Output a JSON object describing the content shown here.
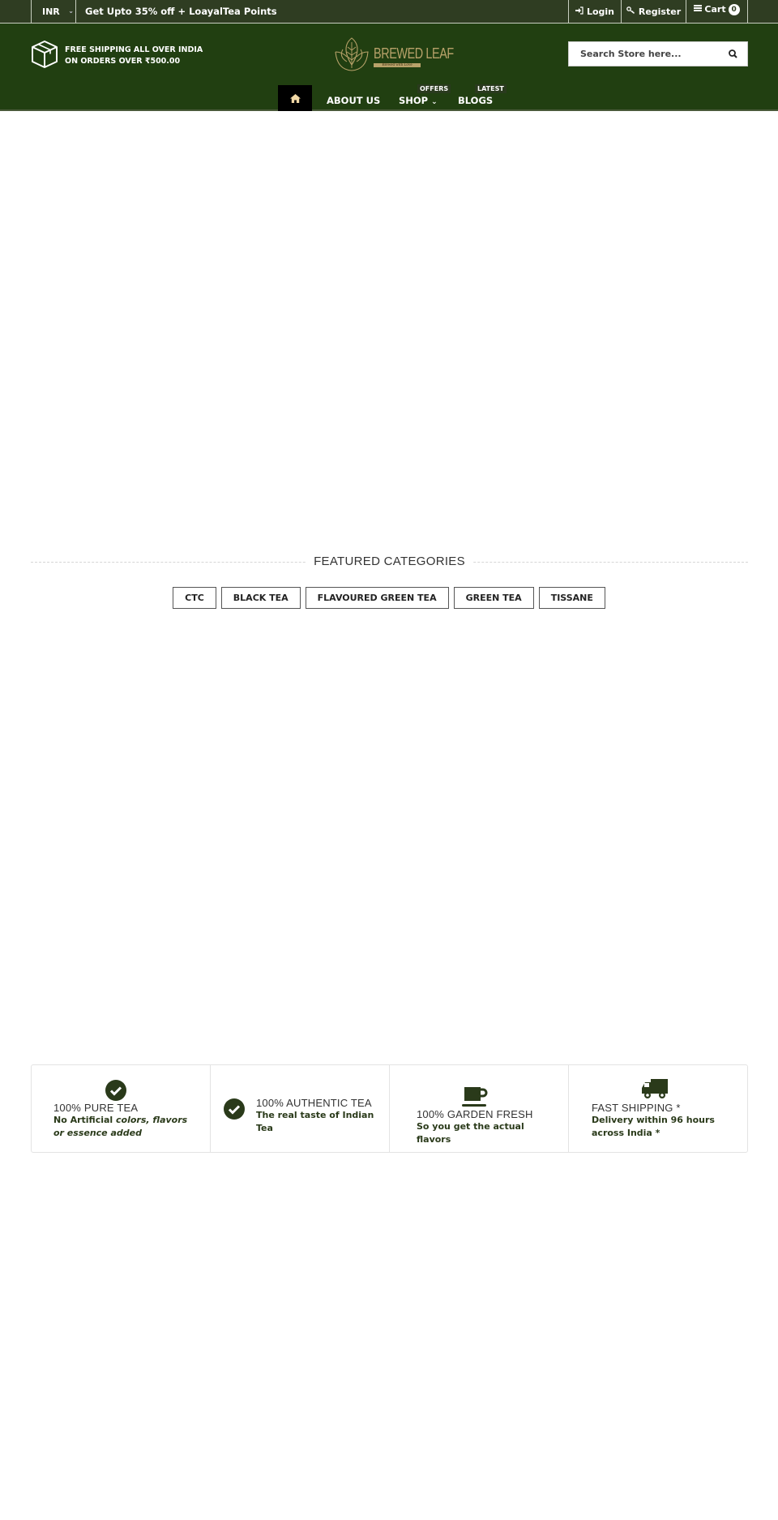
{
  "topbar": {
    "currency": "INR",
    "promo": "Get Upto 35% off + LoayalTea Points",
    "login_label": "Login",
    "register_label": "Register",
    "cart_label": "Cart",
    "cart_count": "0"
  },
  "header": {
    "shipping_line1": "FREE SHIPPING ALL OVER INDIA",
    "shipping_line2": "ON ORDERS OVER ₹500.00",
    "logo_name": "BREWED LEAF",
    "logo_tagline": "Brewed with Love",
    "search_placeholder": "Search Store here..."
  },
  "nav": {
    "items": [
      {
        "label": "ABOUT US",
        "tag": ""
      },
      {
        "label": "SHOP",
        "tag": "OFFERS"
      },
      {
        "label": "BLOGS",
        "tag": "LATEST"
      }
    ]
  },
  "featured": {
    "title": "FEATURED CATEGORIES",
    "categories": [
      "CTC",
      "BLACK TEA",
      "FLAVOURED GREEN TEA",
      "GREEN TEA",
      "TISSANE"
    ]
  },
  "features": [
    {
      "icon": "check-circle-icon",
      "title": "100% PURE TEA",
      "sub_plain": "No Artificial ",
      "sub_italic": "colors, flavors or essence added"
    },
    {
      "icon": "check-circle-icon",
      "title": "100% AUTHENTIC TEA",
      "sub_plain": "The real taste of Indian Tea",
      "sub_italic": ""
    },
    {
      "icon": "coffee-cup-icon",
      "title": "100% GARDEN FRESH",
      "sub_plain": "So you get the actual flavors",
      "sub_italic": ""
    },
    {
      "icon": "truck-icon",
      "title": "FAST SHIPPING *",
      "sub_plain": "Delivery within 96 hours across India *",
      "sub_italic": ""
    }
  ],
  "colors": {
    "topbar_bg": "#2f3d22",
    "header_bg": "#213f11",
    "logo_gold": "#b8a26a",
    "icon_green": "#2a3a1a"
  }
}
